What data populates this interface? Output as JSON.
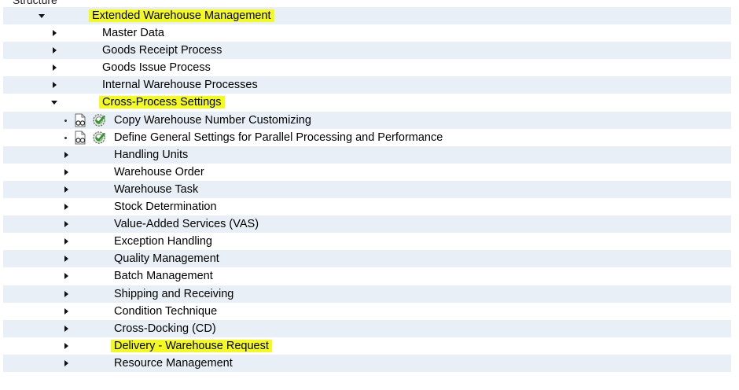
{
  "panel": {
    "title": "Structure"
  },
  "tree": [
    {
      "label": "Extended Warehouse Management",
      "toggle": "expanded",
      "indent": 1,
      "highlight": true,
      "bg": "alt"
    },
    {
      "label": "Master Data",
      "toggle": "collapsed",
      "indent": 2,
      "highlight": false,
      "bg": "plain"
    },
    {
      "label": "Goods Receipt Process",
      "toggle": "collapsed",
      "indent": 2,
      "highlight": false,
      "bg": "alt"
    },
    {
      "label": "Goods Issue Process",
      "toggle": "collapsed",
      "indent": 2,
      "highlight": false,
      "bg": "plain"
    },
    {
      "label": "Internal Warehouse Processes",
      "toggle": "collapsed",
      "indent": 2,
      "highlight": false,
      "bg": "alt"
    },
    {
      "label": "Cross-Process Settings",
      "toggle": "expanded",
      "indent": 2,
      "highlight": true,
      "bg": "plain"
    },
    {
      "label": "Copy Warehouse Number Customizing",
      "toggle": "activity",
      "indent": 3,
      "highlight": false,
      "bg": "alt"
    },
    {
      "label": "Define General Settings for Parallel Processing and Performance",
      "toggle": "activity",
      "indent": 3,
      "highlight": false,
      "bg": "plain"
    },
    {
      "label": "Handling Units",
      "toggle": "collapsed",
      "indent": 3,
      "highlight": false,
      "bg": "alt"
    },
    {
      "label": "Warehouse Order",
      "toggle": "collapsed",
      "indent": 3,
      "highlight": false,
      "bg": "plain"
    },
    {
      "label": "Warehouse Task",
      "toggle": "collapsed",
      "indent": 3,
      "highlight": false,
      "bg": "alt"
    },
    {
      "label": "Stock Determination",
      "toggle": "collapsed",
      "indent": 3,
      "highlight": false,
      "bg": "plain"
    },
    {
      "label": "Value-Added Services (VAS)",
      "toggle": "collapsed",
      "indent": 3,
      "highlight": false,
      "bg": "alt"
    },
    {
      "label": "Exception Handling",
      "toggle": "collapsed",
      "indent": 3,
      "highlight": false,
      "bg": "plain"
    },
    {
      "label": "Quality Management",
      "toggle": "collapsed",
      "indent": 3,
      "highlight": false,
      "bg": "alt"
    },
    {
      "label": "Batch Management",
      "toggle": "collapsed",
      "indent": 3,
      "highlight": false,
      "bg": "plain"
    },
    {
      "label": "Shipping and Receiving",
      "toggle": "collapsed",
      "indent": 3,
      "highlight": false,
      "bg": "alt"
    },
    {
      "label": "Condition Technique",
      "toggle": "collapsed",
      "indent": 3,
      "highlight": false,
      "bg": "plain"
    },
    {
      "label": "Cross-Docking (CD)",
      "toggle": "collapsed",
      "indent": 3,
      "highlight": false,
      "bg": "alt"
    },
    {
      "label": "Delivery - Warehouse Request",
      "toggle": "collapsed",
      "indent": 3,
      "highlight": true,
      "bg": "plain"
    },
    {
      "label": "Resource Management",
      "toggle": "collapsed",
      "indent": 3,
      "highlight": false,
      "bg": "alt"
    }
  ],
  "icons": {
    "activity_doc": "documentation-glasses-icon",
    "activity_exec": "execute-check-icon"
  },
  "colors": {
    "highlight": "#f4f91e",
    "row_alt": "#e8eff6",
    "row_plain": "#ffffff"
  }
}
